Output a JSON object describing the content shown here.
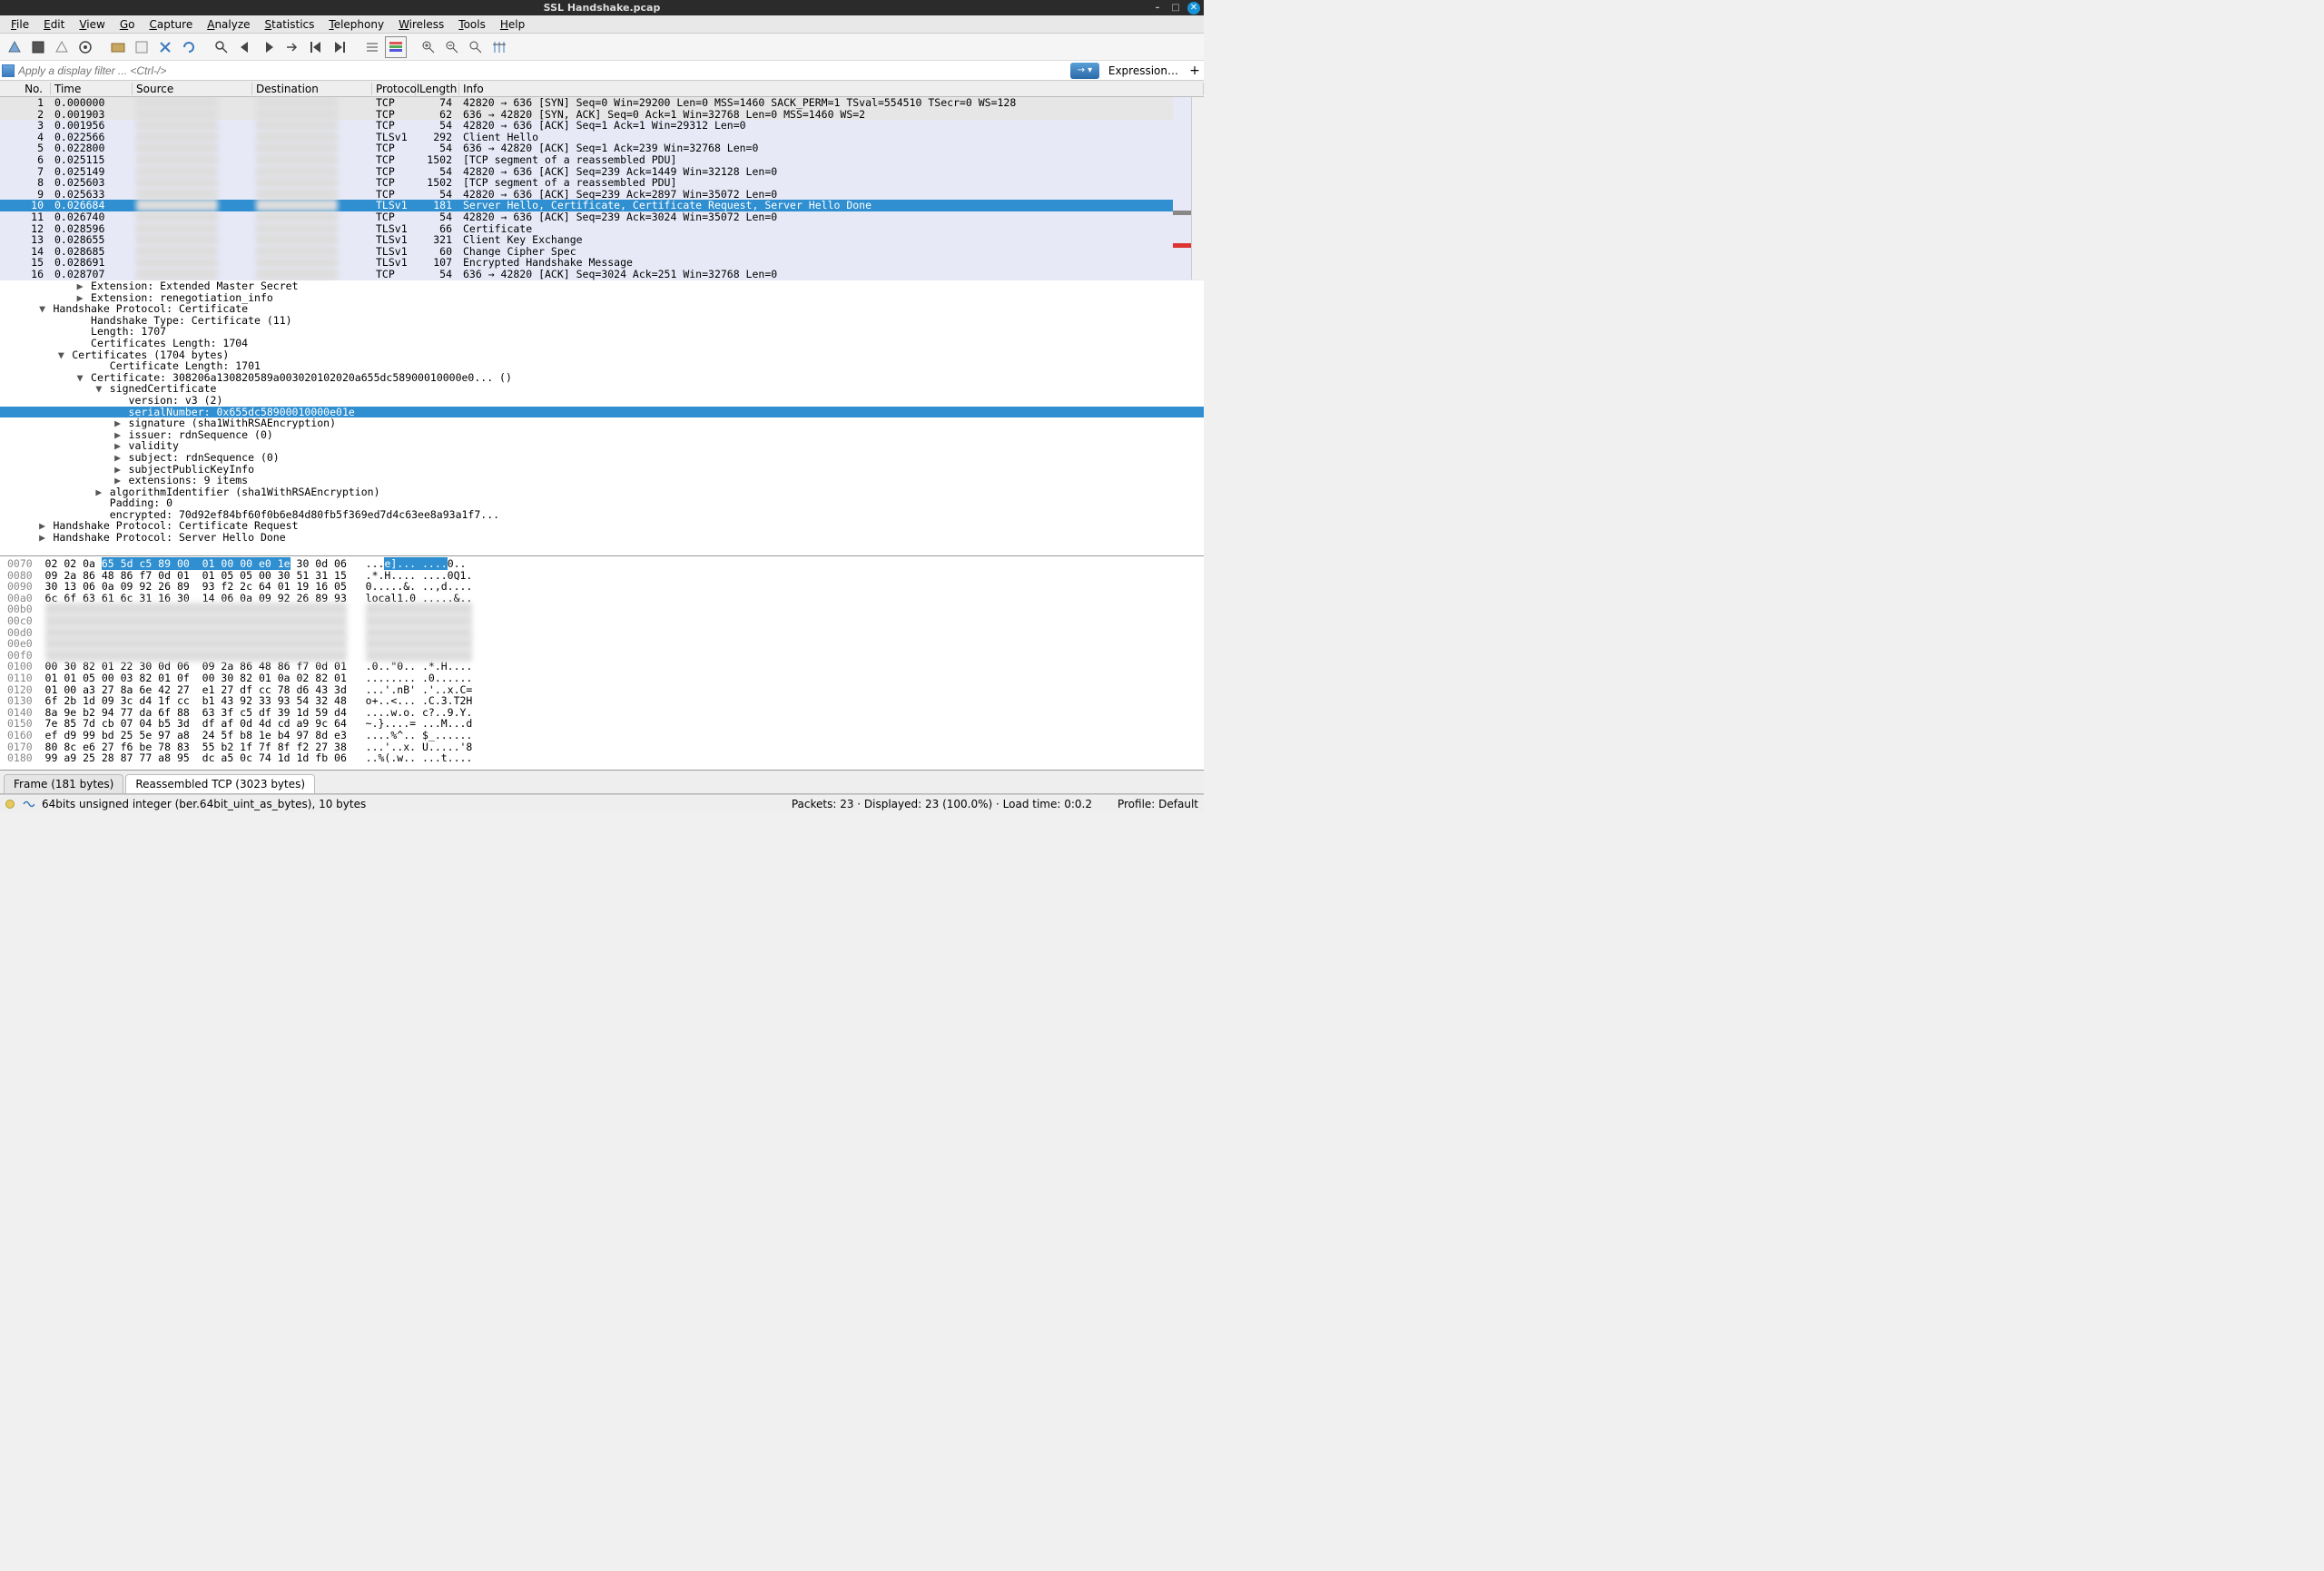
{
  "window": {
    "title": "SSL Handshake.pcap"
  },
  "menu": [
    "File",
    "Edit",
    "View",
    "Go",
    "Capture",
    "Analyze",
    "Statistics",
    "Telephony",
    "Wireless",
    "Tools",
    "Help"
  ],
  "filter": {
    "placeholder": "Apply a display filter ... <Ctrl-/>",
    "expression_label": "Expression…",
    "plus": "+"
  },
  "packet_columns": [
    "No.",
    "Time",
    "Source",
    "Destination",
    "Protocol",
    "Length",
    "Info"
  ],
  "packets": [
    {
      "no": 1,
      "time": "0.000000",
      "proto": "TCP",
      "len": 74,
      "info": "42820 → 636 [SYN] Seq=0 Win=29200 Len=0 MSS=1460 SACK_PERM=1 TSval=554510 TSecr=0 WS=128",
      "bg": "bg0"
    },
    {
      "no": 2,
      "time": "0.001903",
      "proto": "TCP",
      "len": 62,
      "info": "636 → 42820 [SYN, ACK] Seq=0 Ack=1 Win=32768 Len=0 MSS=1460 WS=2",
      "bg": "bg0"
    },
    {
      "no": 3,
      "time": "0.001956",
      "proto": "TCP",
      "len": 54,
      "info": "42820 → 636 [ACK] Seq=1 Ack=1 Win=29312 Len=0",
      "bg": "bg1"
    },
    {
      "no": 4,
      "time": "0.022566",
      "proto": "TLSv1",
      "len": 292,
      "info": "Client Hello",
      "bg": "bg1"
    },
    {
      "no": 5,
      "time": "0.022800",
      "proto": "TCP",
      "len": 54,
      "info": "636 → 42820 [ACK] Seq=1 Ack=239 Win=32768 Len=0",
      "bg": "bg1"
    },
    {
      "no": 6,
      "time": "0.025115",
      "proto": "TCP",
      "len": 1502,
      "info": "[TCP segment of a reassembled PDU]",
      "bg": "bg1"
    },
    {
      "no": 7,
      "time": "0.025149",
      "proto": "TCP",
      "len": 54,
      "info": "42820 → 636 [ACK] Seq=239 Ack=1449 Win=32128 Len=0",
      "bg": "bg1"
    },
    {
      "no": 8,
      "time": "0.025603",
      "proto": "TCP",
      "len": 1502,
      "info": "[TCP segment of a reassembled PDU]",
      "bg": "bg1"
    },
    {
      "no": 9,
      "time": "0.025633",
      "proto": "TCP",
      "len": 54,
      "info": "42820 → 636 [ACK] Seq=239 Ack=2897 Win=35072 Len=0",
      "bg": "bg1"
    },
    {
      "no": 10,
      "time": "0.026684",
      "proto": "TLSv1",
      "len": 181,
      "info": "Server Hello, Certificate, Certificate Request, Server Hello Done",
      "bg": "selected"
    },
    {
      "no": 11,
      "time": "0.026740",
      "proto": "TCP",
      "len": 54,
      "info": "42820 → 636 [ACK] Seq=239 Ack=3024 Win=35072 Len=0",
      "bg": "bg1"
    },
    {
      "no": 12,
      "time": "0.028596",
      "proto": "TLSv1",
      "len": 66,
      "info": "Certificate",
      "bg": "bg1"
    },
    {
      "no": 13,
      "time": "0.028655",
      "proto": "TLSv1",
      "len": 321,
      "info": "Client Key Exchange",
      "bg": "bg1"
    },
    {
      "no": 14,
      "time": "0.028685",
      "proto": "TLSv1",
      "len": 60,
      "info": "Change Cipher Spec",
      "bg": "bg1"
    },
    {
      "no": 15,
      "time": "0.028691",
      "proto": "TLSv1",
      "len": 107,
      "info": "Encrypted Handshake Message",
      "bg": "bg1"
    },
    {
      "no": 16,
      "time": "0.028707",
      "proto": "TCP",
      "len": 54,
      "info": "636 → 42820 [ACK] Seq=3024 Ack=251 Win=32768 Len=0",
      "bg": "bg1"
    }
  ],
  "details": [
    {
      "indent": 4,
      "tri": "▶",
      "text": "Extension: Extended Master Secret"
    },
    {
      "indent": 4,
      "tri": "▶",
      "text": "Extension: renegotiation_info"
    },
    {
      "indent": 2,
      "tri": "▼",
      "text": "Handshake Protocol: Certificate"
    },
    {
      "indent": 4,
      "tri": " ",
      "text": "Handshake Type: Certificate (11)"
    },
    {
      "indent": 4,
      "tri": " ",
      "text": "Length: 1707"
    },
    {
      "indent": 4,
      "tri": " ",
      "text": "Certificates Length: 1704"
    },
    {
      "indent": 3,
      "tri": "▼",
      "text": "Certificates (1704 bytes)"
    },
    {
      "indent": 5,
      "tri": " ",
      "text": "Certificate Length: 1701"
    },
    {
      "indent": 4,
      "tri": "▼",
      "text": "Certificate: 308206a130820589a003020102020a655dc58900010000e0... ()"
    },
    {
      "indent": 5,
      "tri": "▼",
      "text": "signedCertificate"
    },
    {
      "indent": 6,
      "tri": " ",
      "text": "version: v3 (2)"
    },
    {
      "indent": 6,
      "tri": " ",
      "text": "serialNumber: 0x655dc58900010000e01e",
      "selected": true
    },
    {
      "indent": 6,
      "tri": "▶",
      "text": "signature (sha1WithRSAEncryption)"
    },
    {
      "indent": 6,
      "tri": "▶",
      "text": "issuer: rdnSequence (0)"
    },
    {
      "indent": 6,
      "tri": "▶",
      "text": "validity"
    },
    {
      "indent": 6,
      "tri": "▶",
      "text": "subject: rdnSequence (0)"
    },
    {
      "indent": 6,
      "tri": "▶",
      "text": "subjectPublicKeyInfo"
    },
    {
      "indent": 6,
      "tri": "▶",
      "text": "extensions: 9 items"
    },
    {
      "indent": 5,
      "tri": "▶",
      "text": "algorithmIdentifier (sha1WithRSAEncryption)"
    },
    {
      "indent": 5,
      "tri": " ",
      "text": "Padding: 0"
    },
    {
      "indent": 5,
      "tri": " ",
      "text": "encrypted: 70d92ef84bf60f0b6e84d80fb5f369ed7d4c63ee8a93a1f7..."
    },
    {
      "indent": 2,
      "tri": "▶",
      "text": "Handshake Protocol: Certificate Request"
    },
    {
      "indent": 2,
      "tri": "▶",
      "text": "Handshake Protocol: Server Hello Done"
    }
  ],
  "hex": [
    {
      "off": "0070",
      "h": "02 02 0a ",
      "hl": "65 5d c5 89 00  01 00 00 e0 1e",
      "h2": " 30 0d 06",
      "a": "   ...",
      "al": "e]... ....",
      "a2": "0..",
      "blur": false
    },
    {
      "off": "0080",
      "h": "09 2a 86 48 86 f7 0d 01  01 05 05 00 30 51 31 15",
      "a": "   .*.H.... ....0Q1."
    },
    {
      "off": "0090",
      "h": "30 13 06 0a 09 92 26 89  93 f2 2c 64 01 19 16 05",
      "a": "   0.....&. ..,d...."
    },
    {
      "off": "00a0",
      "h": "6c 6f 63 61 6c 31 16 30  14 06 0a 09 92 26 89 93",
      "a": "   local1.0 .....&.."
    },
    {
      "off": "00b0",
      "blur": true
    },
    {
      "off": "00c0",
      "blur": true
    },
    {
      "off": "00d0",
      "blur": true
    },
    {
      "off": "00e0",
      "blur": true
    },
    {
      "off": "00f0",
      "blur": true
    },
    {
      "off": "0100",
      "h": "00 30 82 01 22 30 0d 06  09 2a 86 48 86 f7 0d 01",
      "a": "   .0..\"0.. .*.H...."
    },
    {
      "off": "0110",
      "h": "01 01 05 00 03 82 01 0f  00 30 82 01 0a 02 82 01",
      "a": "   ........ .0......"
    },
    {
      "off": "0120",
      "h": "01 00 a3 27 8a 6e 42 27  e1 27 df cc 78 d6 43 3d",
      "a": "   ...'.nB' .'..x.C="
    },
    {
      "off": "0130",
      "h": "6f 2b 1d 09 3c d4 1f cc  b1 43 92 33 93 54 32 48",
      "a": "   o+..<... .C.3.T2H"
    },
    {
      "off": "0140",
      "h": "8a 9e b2 94 77 da 6f 88  63 3f c5 df 39 1d 59 d4",
      "a": "   ....w.o. c?..9.Y."
    },
    {
      "off": "0150",
      "h": "7e 85 7d cb 07 04 b5 3d  df af 0d 4d cd a9 9c 64",
      "a": "   ~.}....= ...M...d"
    },
    {
      "off": "0160",
      "h": "ef d9 99 bd 25 5e 97 a8  24 5f b8 1e b4 97 8d e3",
      "a": "   ....%^.. $_......"
    },
    {
      "off": "0170",
      "h": "80 8c e6 27 f6 be 78 83  55 b2 1f 7f 8f f2 27 38",
      "a": "   ...'..x. U.....'8"
    },
    {
      "off": "0180",
      "h": "99 a9 25 28 87 77 a8 95  dc a5 0c 74 1d 1d fb 06",
      "a": "   ..%(.w.. ...t...."
    }
  ],
  "bytes_tabs": {
    "frame": "Frame (181 bytes)",
    "reassembled": "Reassembled TCP (3023 bytes)"
  },
  "status": {
    "field": "64bits unsigned integer (ber.64bit_uint_as_bytes), 10 bytes",
    "packets": "Packets: 23 · Displayed: 23 (100.0%) · Load time: 0:0.2",
    "profile": "Profile: Default"
  }
}
